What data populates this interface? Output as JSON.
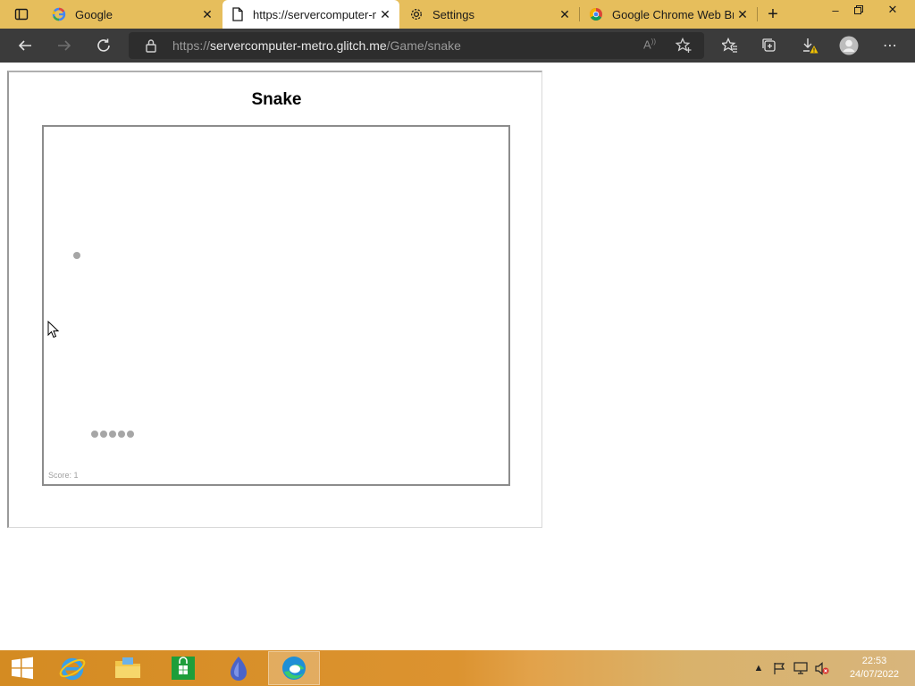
{
  "browser": {
    "tabs": [
      {
        "title": "Google",
        "icon": "google-g-icon",
        "active": false
      },
      {
        "title": "https://servercomputer-metro.glitch.me/Game/snake",
        "icon": "page-icon",
        "active": true
      },
      {
        "title": "Settings",
        "icon": "gear-icon",
        "active": false
      },
      {
        "title": "Google Chrome Web Browser",
        "icon": "chrome-icon",
        "active": false
      }
    ],
    "new_tab_label": "+",
    "address": {
      "prefix": "https://",
      "host": "servercomputer-metro.glitch.me",
      "path": "/Game/snake"
    }
  },
  "game": {
    "title": "Snake",
    "score_text": "Score: 1",
    "food": {
      "col": 4,
      "row": 16
    },
    "snake": [
      {
        "col": 6,
        "row": 36
      },
      {
        "col": 7,
        "row": 36
      },
      {
        "col": 8,
        "row": 36
      },
      {
        "col": 9,
        "row": 36
      },
      {
        "col": 10,
        "row": 36
      }
    ],
    "grid": {
      "cols": 52,
      "rows": 40
    }
  },
  "taskbar": {
    "apps": [
      "internet-explorer-icon",
      "file-explorer-icon",
      "store-icon",
      "app-icon",
      "edge-icon"
    ],
    "clock_time": "22:53",
    "clock_date": "24/07/2022"
  },
  "colors": {
    "tabbar": "#e6be5c",
    "toolbar": "#3b3b3b",
    "snake": "#a6a6a6"
  }
}
